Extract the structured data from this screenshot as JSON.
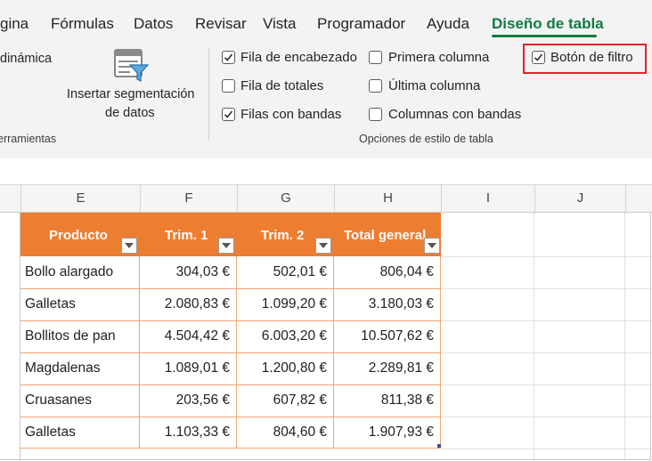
{
  "tabs": [
    "gina",
    "Fórmulas",
    "Datos",
    "Revisar",
    "Vista",
    "Programador",
    "Ayuda",
    "Diseño de tabla"
  ],
  "active_tab": "Diseño de tabla",
  "ribbon": {
    "pivot_fragment": "dinámica",
    "slicer_label_line1": "Insertar segmentación",
    "slicer_label_line2": "de datos",
    "tools_group_label": "Herramientas",
    "style_options_group_label": "Opciones de estilo de tabla",
    "options": [
      {
        "label": "Fila de encabezado",
        "checked": true
      },
      {
        "label": "Fila de totales",
        "checked": false
      },
      {
        "label": "Filas con bandas",
        "checked": true
      },
      {
        "label": "Primera columna",
        "checked": false
      },
      {
        "label": "Última columna",
        "checked": false
      },
      {
        "label": "Columnas con bandas",
        "checked": false
      },
      {
        "label": "Botón de filtro",
        "checked": true
      }
    ]
  },
  "columns": [
    "E",
    "F",
    "G",
    "H",
    "I",
    "J"
  ],
  "table": {
    "headers": [
      "Producto",
      "Trim. 1",
      "Trim. 2",
      "Total general"
    ],
    "rows": [
      [
        "Bollo alargado",
        "304,03 €",
        "502,01 €",
        "806,04 €"
      ],
      [
        "Galletas",
        "2.080,83 €",
        "1.099,20 €",
        "3.180,03 €"
      ],
      [
        "Bollitos de pan",
        "4.504,42 €",
        "6.003,20 €",
        "10.507,62 €"
      ],
      [
        "Magdalenas",
        "1.089,01 €",
        "1.200,80 €",
        "2.289,81 €"
      ],
      [
        "Cruasanes",
        "203,56 €",
        "607,82 €",
        "811,38 €"
      ],
      [
        "Galletas",
        "1.103,33 €",
        "804,60 €",
        "1.907,93 €"
      ]
    ]
  },
  "colors": {
    "accent": "#107c41",
    "table_header": "#ed7d31",
    "table_border": "#f0a472",
    "highlight": "#e0242a"
  }
}
